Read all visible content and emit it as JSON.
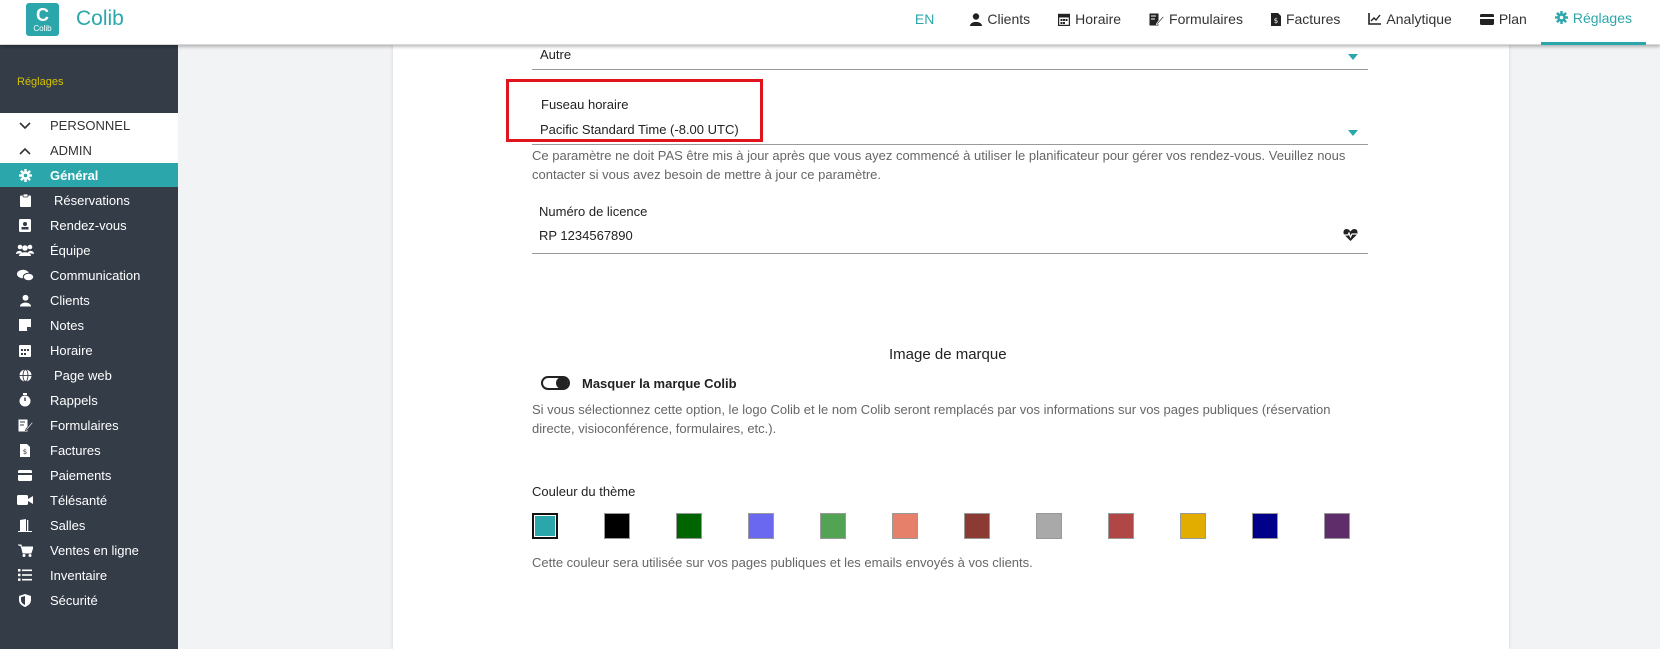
{
  "app": {
    "logo_letter": "C",
    "logo_text": "Colib",
    "brand": "Colib"
  },
  "nav": {
    "lang": "EN",
    "items": [
      {
        "label": "Clients",
        "icon": "user-icon"
      },
      {
        "label": "Horaire",
        "icon": "calendar-icon"
      },
      {
        "label": "Formulaires",
        "icon": "form-edit-icon"
      },
      {
        "label": "Factures",
        "icon": "invoice-icon"
      },
      {
        "label": "Analytique",
        "icon": "chart-icon"
      },
      {
        "label": "Plan",
        "icon": "credit-card-icon"
      },
      {
        "label": "Réglages",
        "icon": "gear-icon"
      }
    ]
  },
  "sidebar": {
    "title": "Réglages",
    "sections": [
      {
        "label": "PERSONNEL",
        "icon": "chevron-down-icon"
      },
      {
        "label": "ADMIN",
        "icon": "chevron-up-icon"
      }
    ],
    "items": [
      {
        "label": "Général",
        "icon": "gear-icon"
      },
      {
        "label": "Réservations",
        "icon": "clipboard-icon"
      },
      {
        "label": "Rendez-vous",
        "icon": "appointment-icon"
      },
      {
        "label": "Équipe",
        "icon": "team-icon"
      },
      {
        "label": "Communication",
        "icon": "chat-icon"
      },
      {
        "label": "Clients",
        "icon": "user-icon"
      },
      {
        "label": "Notes",
        "icon": "note-icon"
      },
      {
        "label": "Horaire",
        "icon": "calendar-icon"
      },
      {
        "label": "Page web",
        "icon": "globe-icon"
      },
      {
        "label": "Rappels",
        "icon": "stopwatch-icon"
      },
      {
        "label": "Formulaires",
        "icon": "form-edit-icon"
      },
      {
        "label": "Factures",
        "icon": "invoice-icon"
      },
      {
        "label": "Paiements",
        "icon": "credit-card-icon"
      },
      {
        "label": "Télésanté",
        "icon": "video-icon"
      },
      {
        "label": "Salles",
        "icon": "door-icon"
      },
      {
        "label": "Ventes en ligne",
        "icon": "cart-icon"
      },
      {
        "label": "Inventaire",
        "icon": "list-icon"
      },
      {
        "label": "Sécurité",
        "icon": "shield-icon"
      }
    ]
  },
  "form": {
    "top_select_value": "Autre",
    "timezone": {
      "label": "Fuseau horaire",
      "value": "Pacific Standard Time (-8.00 UTC)",
      "hint": "Ce paramètre ne doit PAS être mis à jour après que vous ayez commencé à utiliser le planificateur pour gérer vos rendez-vous. Veuillez nous contacter si vous avez besoin de mettre à jour ce paramètre."
    },
    "license": {
      "label": "Numéro de licence",
      "value": "RP 1234567890"
    },
    "branding": {
      "title": "Image de marque",
      "toggle_label": "Masquer la marque Colib",
      "toggle_on": true,
      "hint": "Si vous sélectionnez cette option, le logo Colib et le nom Colib seront remplacés par vos informations sur vos pages publiques (réservation directe, visioconférence, formulaires, etc.)."
    },
    "theme": {
      "label": "Couleur du thème",
      "colors": [
        "#2ba7ab",
        "#000000",
        "#006400",
        "#6a67f0",
        "#52a353",
        "#e7806a",
        "#8b3a34",
        "#a9a9a9",
        "#b04646",
        "#e3ad00",
        "#00008b",
        "#5e2d6a"
      ],
      "selected_index": 0,
      "hint": "Cette couleur sera utilisée sur vos pages publiques et les emails envoyés à vos clients."
    }
  },
  "colors": {
    "accent": "#2ba7ab",
    "sidebar_bg": "#343c48",
    "highlight": "#e0141c"
  }
}
